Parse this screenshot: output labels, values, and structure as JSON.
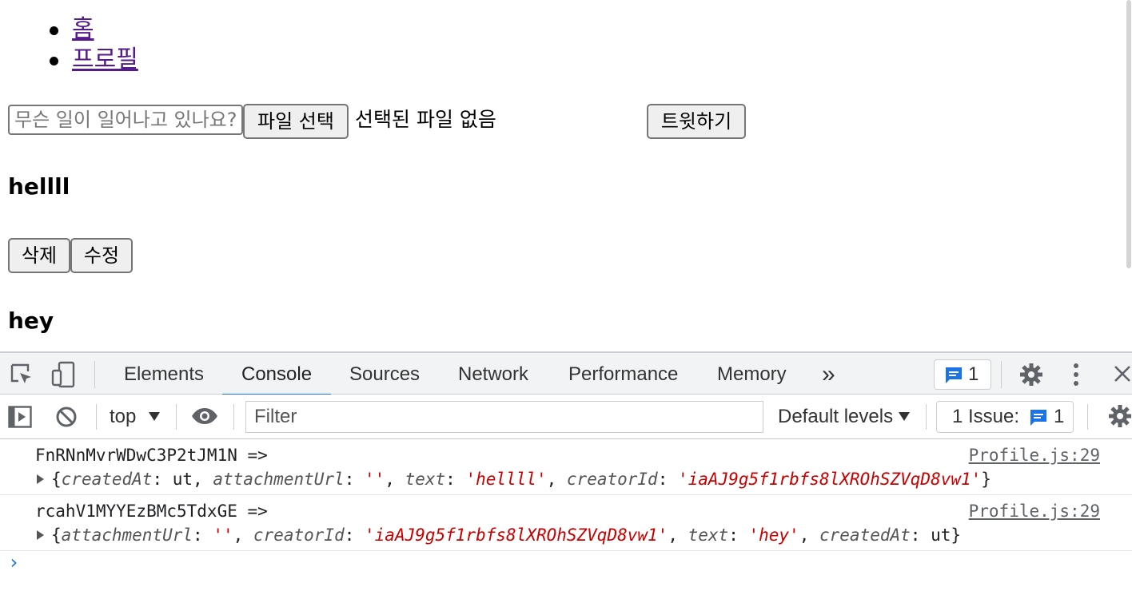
{
  "nav": {
    "items": [
      {
        "label": "홈"
      },
      {
        "label": "프로필"
      }
    ]
  },
  "form": {
    "placeholder": "무슨 일이 일어나고 있나요?",
    "file_button": "파일 선택",
    "file_status": "선택된 파일 없음",
    "submit": "트윗하기"
  },
  "tweets": [
    {
      "text": "hellll",
      "delete": "삭제",
      "edit": "수정"
    },
    {
      "text": "hey"
    }
  ],
  "devtools": {
    "tabs": [
      "Elements",
      "Console",
      "Sources",
      "Network",
      "Performance",
      "Memory"
    ],
    "active_tab": "Console",
    "more": "»",
    "message_badge": "1",
    "toolbar": {
      "context": "top",
      "filter_placeholder": "Filter",
      "levels": "Default levels",
      "issues_label": "1 Issue:",
      "issues_count": "1"
    },
    "console": [
      {
        "key": "FnRNnMvrWDwC3P2tJM1N =>",
        "source": "Profile.js:29",
        "object": [
          {
            "t": "p",
            "v": "{"
          },
          {
            "t": "k",
            "v": "createdAt"
          },
          {
            "t": "p",
            "v": ": ut, "
          },
          {
            "t": "k",
            "v": "attachmentUrl"
          },
          {
            "t": "p",
            "v": ": "
          },
          {
            "t": "s",
            "v": "''"
          },
          {
            "t": "p",
            "v": ", "
          },
          {
            "t": "k",
            "v": "text"
          },
          {
            "t": "p",
            "v": ": "
          },
          {
            "t": "s",
            "v": "'hellll'"
          },
          {
            "t": "p",
            "v": ", "
          },
          {
            "t": "k",
            "v": "creatorId"
          },
          {
            "t": "p",
            "v": ": "
          },
          {
            "t": "s",
            "v": "'iaAJ9g5f1rbfs8lXROhSZVqD8vw1'"
          },
          {
            "t": "p",
            "v": "}"
          }
        ]
      },
      {
        "key": "rcahV1MYYEzBMc5TdxGE =>",
        "source": "Profile.js:29",
        "object": [
          {
            "t": "p",
            "v": "{"
          },
          {
            "t": "k",
            "v": "attachmentUrl"
          },
          {
            "t": "p",
            "v": ": "
          },
          {
            "t": "s",
            "v": "''"
          },
          {
            "t": "p",
            "v": ", "
          },
          {
            "t": "k",
            "v": "creatorId"
          },
          {
            "t": "p",
            "v": ": "
          },
          {
            "t": "s",
            "v": "'iaAJ9g5f1rbfs8lXROhSZVqD8vw1'"
          },
          {
            "t": "p",
            "v": ", "
          },
          {
            "t": "k",
            "v": "text"
          },
          {
            "t": "p",
            "v": ": "
          },
          {
            "t": "s",
            "v": "'hey'"
          },
          {
            "t": "p",
            "v": ", "
          },
          {
            "t": "k",
            "v": "createdAt"
          },
          {
            "t": "p",
            "v": ": ut"
          },
          {
            "t": "p",
            "v": "}"
          }
        ]
      }
    ],
    "prompt": "›"
  },
  "colors": {
    "accent": "#1a73e8",
    "link": "#551a8b",
    "string": "#c80000"
  }
}
